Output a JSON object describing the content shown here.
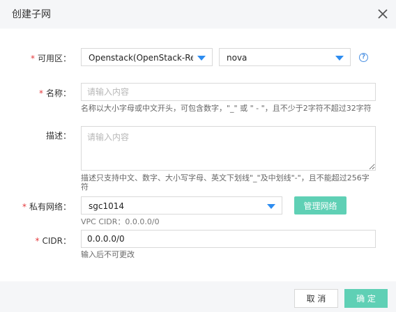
{
  "dialog": {
    "title": "创建子网",
    "close_label": "×"
  },
  "form": {
    "required_mark": "*",
    "availability_zone": {
      "label": "可用区：",
      "primary_value": "Openstack(OpenStack-Reg",
      "secondary_value": "nova",
      "help_glyph": "?"
    },
    "name": {
      "label": "名称：",
      "placeholder": "请输入内容",
      "hint": "名称以大小字母或中文开头，可包含数字，\"_\" 或 \" - \"，且不少于2字符不超过32字符"
    },
    "description": {
      "label": "描述：",
      "placeholder": "请输入内容",
      "hint": "描述只支持中文、数字、大小写字母、英文下划线\"_\"及中划线\"-\"，且不能超过256字符"
    },
    "private_network": {
      "label": "私有网络：",
      "value": "sgc1014",
      "manage_button": "管理网络",
      "vpc_cidr": "VPC CIDR：0.0.0.0/0"
    },
    "cidr": {
      "label": "CIDR：",
      "value": "0.0.0.0/0",
      "hint": "输入后不可更改"
    }
  },
  "footer": {
    "cancel_label": "取 消",
    "confirm_label": "确 定"
  },
  "colors": {
    "accent": "#5fd0b5",
    "caret": "#2d8cf0",
    "required": "#e4393c"
  }
}
